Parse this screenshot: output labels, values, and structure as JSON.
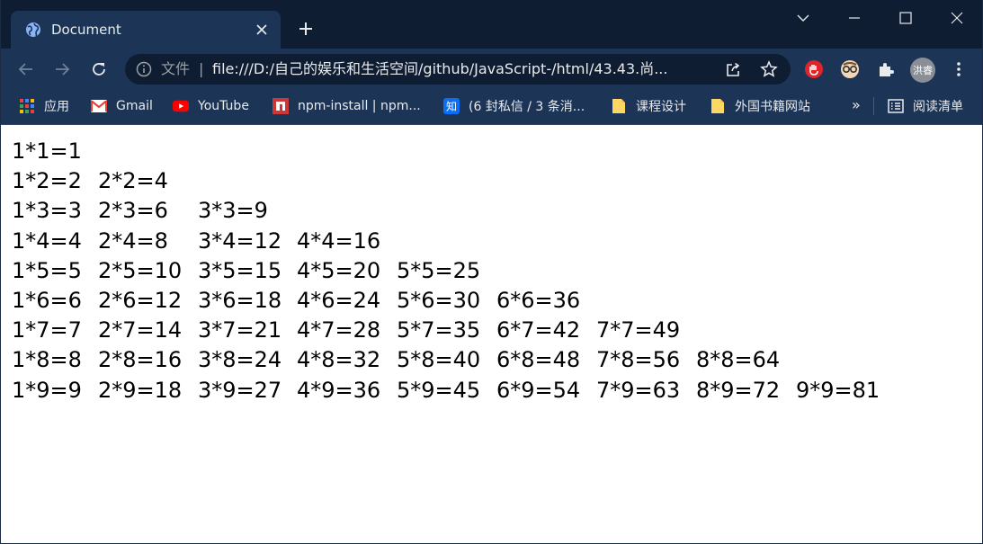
{
  "tab": {
    "title": "Document",
    "favicon": "globe-icon"
  },
  "window_controls": [
    "minimize-icon",
    "maximize-icon",
    "close-icon"
  ],
  "omnibox": {
    "scheme_label": "文件",
    "separator": "|",
    "url": "file:///D:/自己的娱乐和生活空间/github/JavaScript-/html/43.43.尚..."
  },
  "profile": {
    "avatar_label": "洪睿"
  },
  "bookmarks": [
    {
      "label": "应用",
      "icon": "apps-grid-icon"
    },
    {
      "label": "Gmail",
      "icon": "gmail-icon"
    },
    {
      "label": "YouTube",
      "icon": "youtube-icon"
    },
    {
      "label": "npm-install | npm...",
      "icon": "npm-icon"
    },
    {
      "label": "(6 封私信 / 3 条消...",
      "icon": "zhihu-icon"
    },
    {
      "label": "课程设计",
      "icon": "folder-icon"
    },
    {
      "label": "外国书籍网站",
      "icon": "folder-icon"
    }
  ],
  "bookmarks_more": "»",
  "reading_list": {
    "label": "阅读清单",
    "icon": "reading-list-icon"
  },
  "multiplication_table": [
    [
      "1*1=1"
    ],
    [
      "1*2=2",
      "2*2=4"
    ],
    [
      "1*3=3",
      "2*3=6",
      "3*3=9"
    ],
    [
      "1*4=4",
      "2*4=8",
      "3*4=12",
      "4*4=16"
    ],
    [
      "1*5=5",
      "2*5=10",
      "3*5=15",
      "4*5=20",
      "5*5=25"
    ],
    [
      "1*6=6",
      "2*6=12",
      "3*6=18",
      "4*6=24",
      "5*6=30",
      "6*6=36"
    ],
    [
      "1*7=7",
      "2*7=14",
      "3*7=21",
      "4*7=28",
      "5*7=35",
      "6*7=42",
      "7*7=49"
    ],
    [
      "1*8=8",
      "2*8=16",
      "3*8=24",
      "4*8=32",
      "5*8=40",
      "6*8=48",
      "7*8=56",
      "8*8=64"
    ],
    [
      "1*9=9",
      "2*9=18",
      "3*9=27",
      "4*9=36",
      "5*9=45",
      "6*9=54",
      "7*9=63",
      "8*9=72",
      "9*9=81"
    ]
  ]
}
